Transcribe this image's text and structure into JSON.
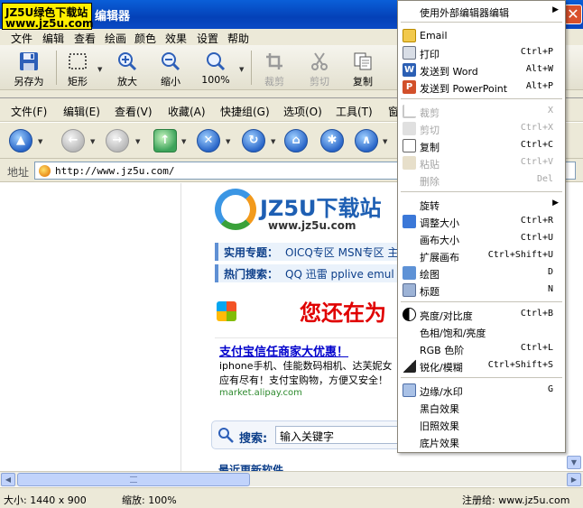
{
  "watermark": {
    "line1": "JZ5U绿色下载站",
    "line2": "www.jz5u.com"
  },
  "window": {
    "title": "编辑器",
    "close_glyph": "✕"
  },
  "menubar": [
    "文件",
    "编辑",
    "查看",
    "绘画",
    "颜色",
    "效果",
    "设置",
    "帮助"
  ],
  "toolbar": [
    {
      "label": "另存为",
      "icon": "save-icon",
      "enabled": true
    },
    {
      "label": "矩形",
      "icon": "rect-select-icon",
      "enabled": true
    },
    {
      "label": "放大",
      "icon": "zoom-in-icon",
      "enabled": true
    },
    {
      "label": "缩小",
      "icon": "zoom-out-icon",
      "enabled": true
    },
    {
      "label": "100%",
      "icon": "zoom-100-icon",
      "enabled": true
    },
    {
      "label": "裁剪",
      "icon": "crop-icon",
      "enabled": false
    },
    {
      "label": "剪切",
      "icon": "scissors-icon",
      "enabled": false
    },
    {
      "label": "复制",
      "icon": "copy-icon",
      "enabled": true
    }
  ],
  "screenshot": {
    "browser_menu": [
      "文件(F)",
      "编辑(E)",
      "查看(V)",
      "收藏(A)",
      "快捷组(G)",
      "选项(O)",
      "工具(T)",
      "窗"
    ],
    "address_label": "地址",
    "address_url": "http://www.jz5u.com/",
    "site": {
      "logo": "JZ5U下载站",
      "logo_sub": "www.jz5u.com",
      "nav1_key": "实用专题：",
      "nav1_links": "OICQ专区  MSN专区  主",
      "nav2_key": "热门搜索：",
      "nav2_links": "QQ 迅雷  pplive emul",
      "banner": "您还在为",
      "ad_title": "支付宝信任商家大优惠！",
      "ad_line1": "iphone手机、佳能数码相机、达芙妮女",
      "ad_line2": "应有尽有！支付宝购物，方便又安全！",
      "ad_url": "market.alipay.com",
      "search_label": "搜索:",
      "search_placeholder": "输入关键字",
      "recent": "最近更新软件"
    }
  },
  "status": {
    "size": "大小: 1440 x 900",
    "zoom": "缩放: 100%",
    "registered": "注册给: www.jz5u.com"
  },
  "context_menu": [
    {
      "label": "使用外部编辑器编辑",
      "submenu": true
    },
    {
      "sep": true
    },
    {
      "label": "Email",
      "icon": "email-icon"
    },
    {
      "label": "打印",
      "shortcut": "Ctrl+P",
      "icon": "printer-icon"
    },
    {
      "label": "发送到 Word",
      "shortcut": "Alt+W",
      "icon": "word-icon"
    },
    {
      "label": "发送到 PowerPoint",
      "shortcut": "Alt+P",
      "icon": "powerpoint-icon"
    },
    {
      "sep": true
    },
    {
      "label": "裁剪",
      "shortcut": "X",
      "icon": "crop-icon",
      "disabled": true
    },
    {
      "label": "剪切",
      "shortcut": "Ctrl+X",
      "icon": "scissors-icon",
      "disabled": true
    },
    {
      "label": "复制",
      "shortcut": "Ctrl+C",
      "icon": "copy-icon"
    },
    {
      "label": "粘贴",
      "shortcut": "Ctrl+V",
      "icon": "paste-icon",
      "disabled": true
    },
    {
      "label": "删除",
      "shortcut": "Del",
      "disabled": true
    },
    {
      "sep": true
    },
    {
      "label": "旋转",
      "submenu": true
    },
    {
      "label": "调整大小",
      "shortcut": "Ctrl+R",
      "icon": "resize-icon"
    },
    {
      "label": "画布大小",
      "shortcut": "Ctrl+U"
    },
    {
      "label": "扩展画布",
      "shortcut": "Ctrl+Shift+U"
    },
    {
      "label": "绘图",
      "shortcut": "D",
      "icon": "draw-icon"
    },
    {
      "label": "标题",
      "shortcut": "N",
      "icon": "caption-icon"
    },
    {
      "sep": true
    },
    {
      "label": "亮度/对比度",
      "shortcut": "Ctrl+B",
      "icon": "contrast-icon"
    },
    {
      "label": "色相/饱和/亮度"
    },
    {
      "label": "RGB 色阶",
      "shortcut": "Ctrl+L"
    },
    {
      "label": "锐化/模糊",
      "shortcut": "Ctrl+Shift+S",
      "icon": "sharpen-icon"
    },
    {
      "sep": true
    },
    {
      "label": "边缘/水印",
      "shortcut": "G",
      "icon": "edge-icon"
    },
    {
      "label": "黑白效果"
    },
    {
      "label": "旧照效果"
    },
    {
      "label": "底片效果"
    }
  ]
}
